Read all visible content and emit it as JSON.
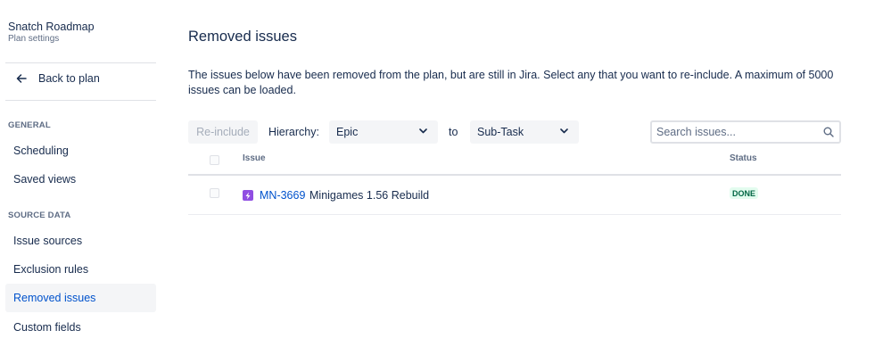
{
  "sidebar": {
    "plan_title": "Snatch Roadmap",
    "plan_subtitle": "Plan settings",
    "back_label": "Back to plan",
    "sections": [
      {
        "heading": "GENERAL",
        "items": [
          "Scheduling",
          "Saved views"
        ]
      },
      {
        "heading": "SOURCE DATA",
        "items": [
          "Issue sources",
          "Exclusion rules",
          "Removed issues",
          "Custom fields"
        ]
      }
    ],
    "active_item": "Removed issues"
  },
  "main": {
    "title": "Removed issues",
    "description": "The issues below have been removed from the plan, but are still in Jira. Select any that you want to re-include. A maximum of 5000 issues can be loaded.",
    "reinclude_label": "Re-include",
    "hierarchy_label": "Hierarchy:",
    "hierarchy_from": "Epic",
    "to_label": "to",
    "hierarchy_to": "Sub-Task",
    "search_placeholder": "Search issues..."
  },
  "table": {
    "columns": [
      "Issue",
      "Status"
    ],
    "rows": [
      {
        "key": "MN-3669",
        "summary": "Minigames 1.56 Rebuild",
        "status": "DONE",
        "type_icon": "epic-lightning-icon"
      }
    ]
  },
  "colors": {
    "accent": "#0052cc",
    "epic": "#904ee2",
    "status_done_bg": "#e3fcef",
    "status_done_text": "#006644"
  }
}
